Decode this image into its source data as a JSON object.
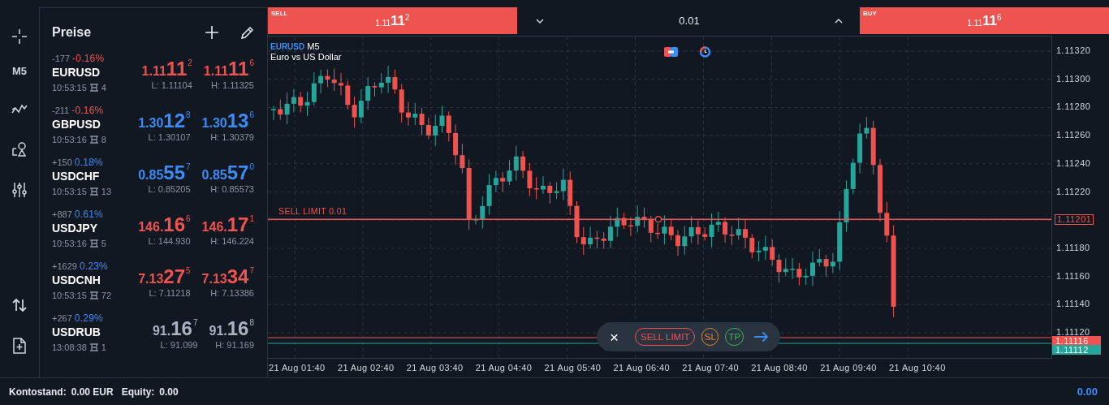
{
  "tool_rail": {
    "timeframe": "M5"
  },
  "prices_panel": {
    "title": "Preise",
    "instruments": [
      {
        "symbol": "EURUSD",
        "change": {
          "points": "-177",
          "pct": "-0.16%",
          "color": "#ef5350"
        },
        "color": "#ef5350",
        "time": "10:53:15",
        "spread": "4",
        "bid": {
          "prefix": "1.11",
          "pips": "11",
          "fraction": "2"
        },
        "ask": {
          "prefix": "1.11",
          "pips": "11",
          "fraction": "6"
        },
        "low": "L: 1.11104",
        "high": "H: 1.11325"
      },
      {
        "symbol": "GBPUSD",
        "change": {
          "points": "-211",
          "pct": "-0.16%",
          "color": "#ef5350"
        },
        "color": "#3d8bf5",
        "time": "10:53:16",
        "spread": "8",
        "bid": {
          "prefix": "1.30",
          "pips": "12",
          "fraction": "8"
        },
        "ask": {
          "prefix": "1.30",
          "pips": "13",
          "fraction": "6"
        },
        "low": "L: 1.30107",
        "high": "H: 1.30379"
      },
      {
        "symbol": "USDCHF",
        "change": {
          "points": "+150",
          "pct": "0.18%",
          "color": "#3d8bf5"
        },
        "color": "#3d8bf5",
        "time": "10:53:15",
        "spread": "13",
        "bid": {
          "prefix": "0.85",
          "pips": "55",
          "fraction": "7"
        },
        "ask": {
          "prefix": "0.85",
          "pips": "57",
          "fraction": "0"
        },
        "low": "L: 0.85205",
        "high": "H: 0.85573"
      },
      {
        "symbol": "USDJPY",
        "change": {
          "points": "+887",
          "pct": "0.61%",
          "color": "#3d8bf5"
        },
        "color": "#ef5350",
        "time": "10:53:16",
        "spread": "5",
        "bid": {
          "prefix": "146.",
          "pips": "16",
          "fraction": "6"
        },
        "ask": {
          "prefix": "146.",
          "pips": "17",
          "fraction": "1"
        },
        "low": "L: 144.930",
        "high": "H: 146.224"
      },
      {
        "symbol": "USDCNH",
        "change": {
          "points": "+1629",
          "pct": "0.23%",
          "color": "#3d8bf5"
        },
        "color": "#ef5350",
        "time": "10:53:15",
        "spread": "72",
        "bid": {
          "prefix": "7.13",
          "pips": "27",
          "fraction": "5"
        },
        "ask": {
          "prefix": "7.13",
          "pips": "34",
          "fraction": "7"
        },
        "low": "L: 7.11218",
        "high": "H: 7.13386"
      },
      {
        "symbol": "USDRUB",
        "change": {
          "points": "+267",
          "pct": "0.29%",
          "color": "#3d8bf5"
        },
        "color": "#a9b3c1",
        "time": "13:08:38",
        "spread": "1",
        "bid": {
          "prefix": "91.",
          "pips": "16",
          "fraction": "7"
        },
        "ask": {
          "prefix": "91.",
          "pips": "16",
          "fraction": "8"
        },
        "low": "L: 91.099",
        "high": "H: 91.169"
      }
    ]
  },
  "trade_bar": {
    "sell": {
      "label": "SELL",
      "prefix": "1.11",
      "pips": "11",
      "fraction": "2"
    },
    "volume": "0.01",
    "buy": {
      "label": "BUY",
      "prefix": "1.11",
      "pips": "11",
      "fraction": "6"
    }
  },
  "chart": {
    "symbol": "EURUSD",
    "timeframe": "M5",
    "description": "Euro vs US Dollar",
    "price_ticks": [
      {
        "label": "1.11320",
        "kind": "tick"
      },
      {
        "label": "1.11300",
        "kind": "tick"
      },
      {
        "label": "1.11280",
        "kind": "tick"
      },
      {
        "label": "1.11260",
        "kind": "tick"
      },
      {
        "label": "1.11240",
        "kind": "tick"
      },
      {
        "label": "1.11220",
        "kind": "tick"
      },
      {
        "label": "1.11201",
        "kind": "order"
      },
      {
        "label": "1.11180",
        "kind": "tick"
      },
      {
        "label": "1.11160",
        "kind": "tick"
      },
      {
        "label": "1.11140",
        "kind": "tick"
      },
      {
        "label": "1.11120",
        "kind": "tick"
      }
    ],
    "bid_tag": "1.11116",
    "ask_tag": "1.11112",
    "time_ticks": [
      "21 Aug 01:40",
      "21 Aug 02:40",
      "21 Aug 03:40",
      "21 Aug 04:40",
      "21 Aug 05:40",
      "21 Aug 06:40",
      "21 Aug 07:40",
      "21 Aug 08:40",
      "21 Aug 09:40",
      "21 Aug 10:40"
    ],
    "order_line": {
      "label": "SELL LIMIT 0.01"
    },
    "order_toolbar": {
      "close": "×",
      "type": "SELL LIMIT",
      "sl": "SL",
      "tp": "TP"
    }
  },
  "status_bar": {
    "balance_label": "Kontostand:",
    "balance": "0.00 EUR",
    "equity_label": "Equity:",
    "equity": "0.00",
    "total": "0.00"
  }
}
